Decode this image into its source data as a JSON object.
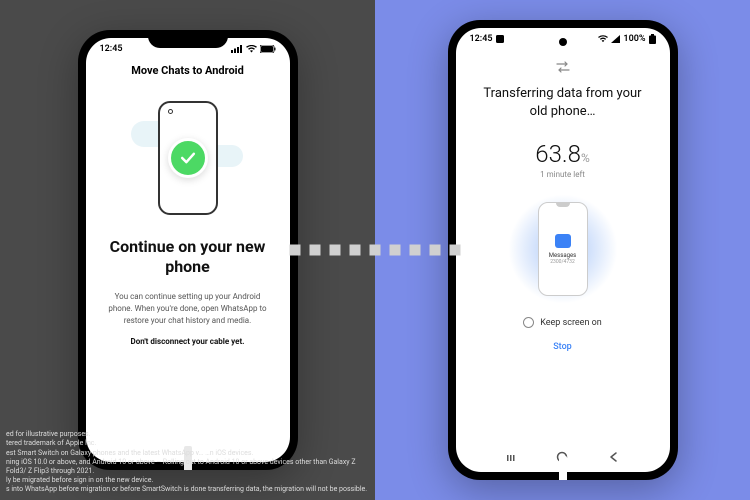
{
  "left_phone": {
    "status_time": "12:45",
    "page_title": "Move Chats to Android",
    "heading": "Continue on your new phone",
    "body": "You can continue setting up your Android phone. When you're done, open WhatsApp to restore your chat history and media.",
    "warning": "Don't disconnect your cable yet."
  },
  "right_phone": {
    "status_time": "12:45",
    "battery": "100%",
    "title": "Transferring data from your old phone…",
    "percent": "63.8",
    "percent_symbol": "%",
    "time_left": "1 minute left",
    "item_label": "Messages",
    "item_count": "2300/4732",
    "keep_screen": "Keep screen on",
    "stop": "Stop"
  },
  "disclaimer": {
    "l1": "ed for illustrative purposes.",
    "l2": "tered trademark of Apple Inc.",
    "l3": "est Smart Switch on Galaxy phones and the latest WhatsApp v… …n iOS devices.",
    "l4": "ning iOS 10.0 or above, and Android 10 or above – Rolling out to Android 10 or above devices other than Galaxy Z Fold3/ Z Flip3 through 2021.",
    "l5": "ly be migrated before sign in on the new device.",
    "l6": "s into WhatsApp before migration or before SmartSwitch is done transferring data, the migration will not be possible."
  }
}
